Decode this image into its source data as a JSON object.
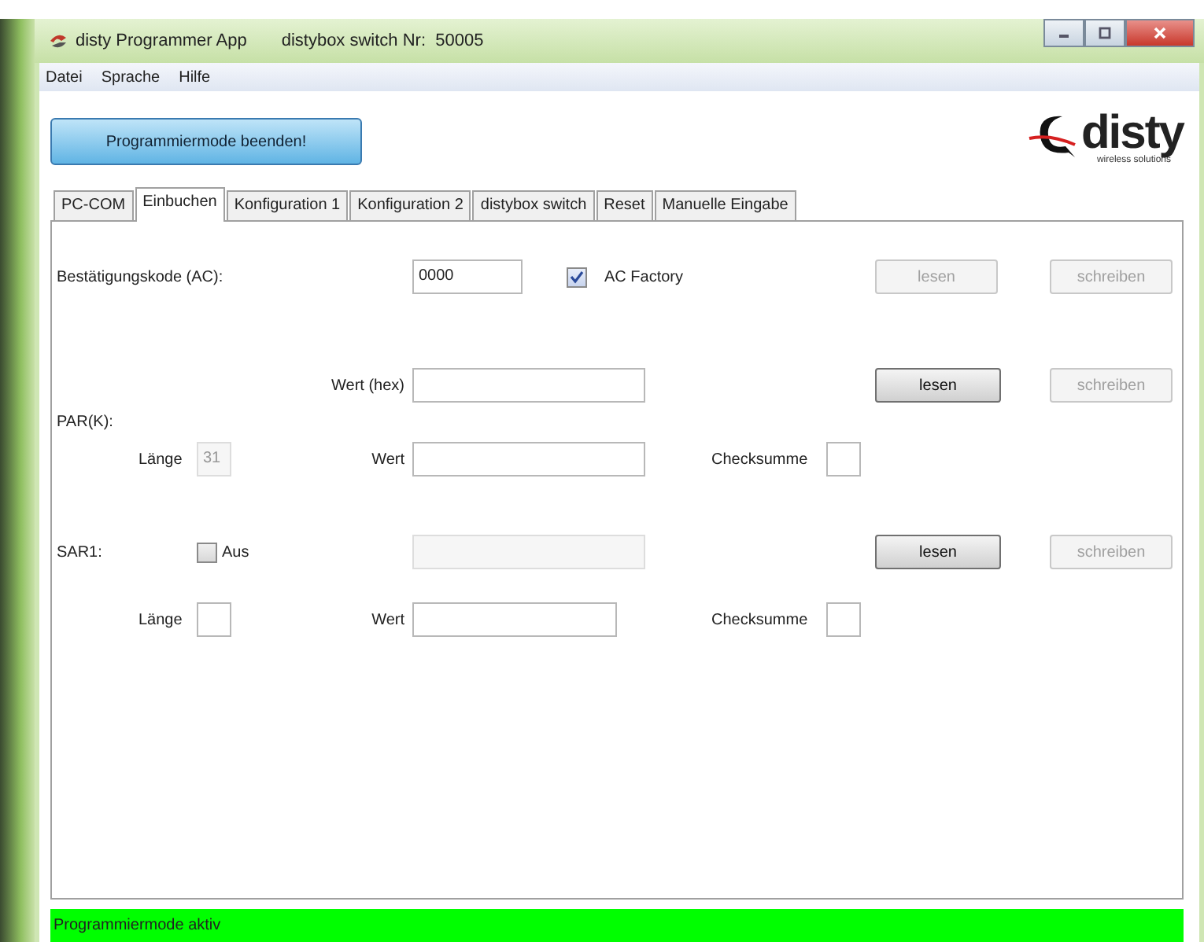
{
  "window": {
    "title": "disty Programmer App",
    "subtitle": "distybox switch Nr:  50005"
  },
  "menu": [
    "Datei",
    "Sprache",
    "Hilfe"
  ],
  "mode_button": "Programmiermode beenden!",
  "logo": {
    "name": "disty",
    "tagline": "wireless solutions"
  },
  "tabs": [
    {
      "label": "PC-COM",
      "selected": false
    },
    {
      "label": "Einbuchen",
      "selected": true
    },
    {
      "label": "Konfiguration 1",
      "selected": false
    },
    {
      "label": "Konfiguration 2",
      "selected": false
    },
    {
      "label": "distybox switch",
      "selected": false
    },
    {
      "label": "Reset",
      "selected": false
    },
    {
      "label": "Manuelle Eingabe",
      "selected": false
    }
  ],
  "ac": {
    "label": "Bestätigungskode (AC):",
    "value": "0000",
    "factory": {
      "label": "AC Factory",
      "checked": true
    },
    "read": {
      "label": "lesen",
      "disabled": true
    },
    "write": {
      "label": "schreiben",
      "disabled": true
    }
  },
  "par": {
    "label": "PAR(K):",
    "hex_label": "Wert (hex)",
    "read": {
      "label": "lesen",
      "disabled": false
    },
    "write": {
      "label": "schreiben",
      "disabled": true
    },
    "length_label": "Länge",
    "length_value": "31",
    "length_disabled": true,
    "value_label": "Wert",
    "checksum_label": "Checksumme"
  },
  "sar": {
    "label": "SAR1:",
    "off": {
      "label": "Aus",
      "checked": false
    },
    "field_disabled": true,
    "read": {
      "label": "lesen",
      "disabled": false
    },
    "write": {
      "label": "schreiben",
      "disabled": true
    },
    "length_label": "Länge",
    "value_label": "Wert",
    "checksum_label": "Checksumme"
  },
  "status": {
    "text": "Programmiermode aktiv",
    "active": true
  }
}
